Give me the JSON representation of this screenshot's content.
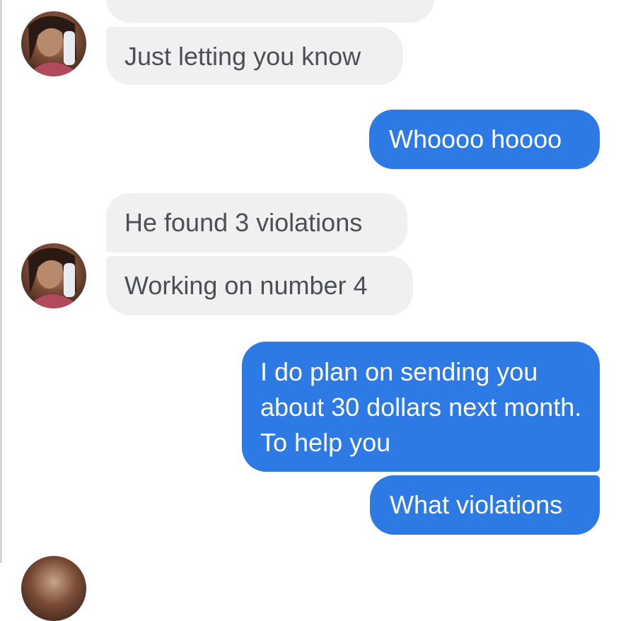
{
  "messages": [
    {
      "text": "Just letting you know"
    },
    {
      "text": "Whoooo hoooo"
    },
    {
      "text": "He found 3 violations"
    },
    {
      "text": "Working on number 4"
    },
    {
      "text": "I do plan on sending you about 30 dollars next month.  To help you"
    },
    {
      "text": "What violations"
    }
  ],
  "colors": {
    "outgoing_bubble": "#2e7ae5",
    "incoming_bubble": "#f1f0f0",
    "incoming_text": "#4b4f56"
  },
  "icons": [
    "contact-avatar"
  ]
}
